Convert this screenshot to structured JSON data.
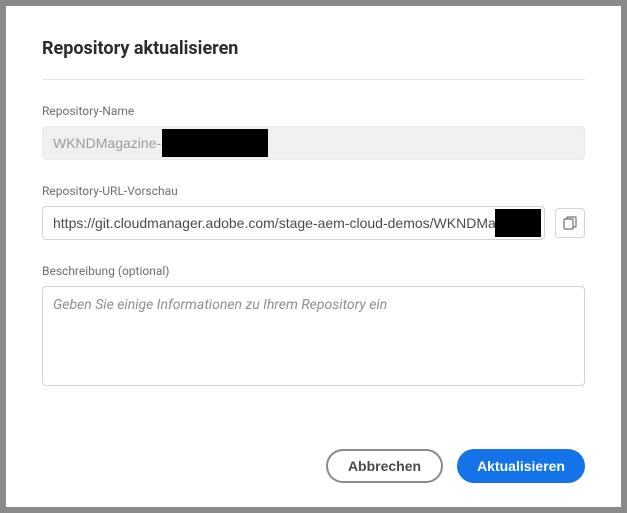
{
  "dialog": {
    "title": "Repository aktualisieren"
  },
  "fields": {
    "name": {
      "label": "Repository-Name",
      "value": "WKNDMagazine-"
    },
    "url": {
      "label": "Repository-URL-Vorschau",
      "value": "https://git.cloudmanager.adobe.com/stage-aem-cloud-demos/WKNDMagazine-"
    },
    "description": {
      "label": "Beschreibung (optional)",
      "placeholder": "Geben Sie einige Informationen zu Ihrem Repository ein"
    }
  },
  "buttons": {
    "cancel": "Abbrechen",
    "submit": "Aktualisieren"
  }
}
